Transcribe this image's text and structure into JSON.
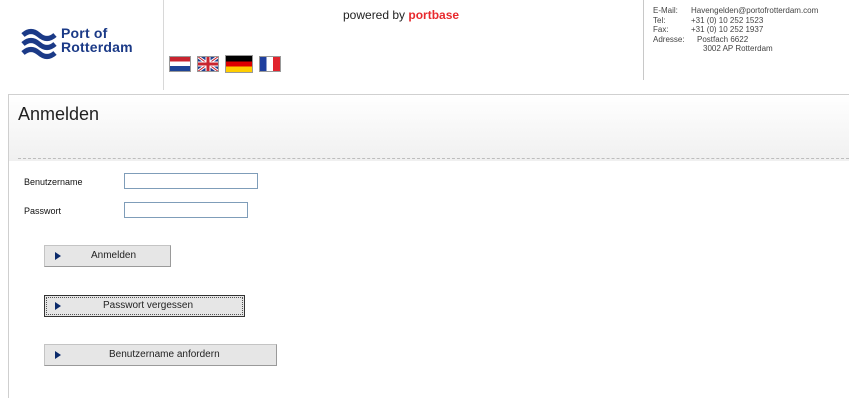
{
  "header": {
    "logo": {
      "line1": "Port of",
      "line2": "Rotterdam"
    },
    "powered_by": "powered by",
    "powered_brand": "portbase",
    "flags": [
      "nl-flag",
      "uk-flag",
      "de-flag",
      "fr-flag"
    ],
    "contact": {
      "email_label": "E-Mail:",
      "email": "Havengelden@portofrotterdam.com",
      "tel_label": "Tel:",
      "tel": "+31 (0) 10 252 1523",
      "fax_label": "Fax:",
      "fax": "+31 (0) 10 252 1937",
      "address_label": "Adresse:",
      "address_line1": "Postfach 6622",
      "address_line2": "3002 AP  Rotterdam"
    }
  },
  "page": {
    "title": "Anmelden"
  },
  "form": {
    "username_label": "Benutzername",
    "username_value": "",
    "password_label": "Passwort",
    "password_value": ""
  },
  "buttons": {
    "login": "Anmelden",
    "forgot_password": "Passwort vergessen",
    "request_username": "Benutzername anfordern"
  },
  "colors": {
    "brand_blue": "#1b3a87",
    "portbase_red": "#e8292d",
    "button_bg": "#e6e6e6",
    "arrow": "#0b2a6b"
  }
}
